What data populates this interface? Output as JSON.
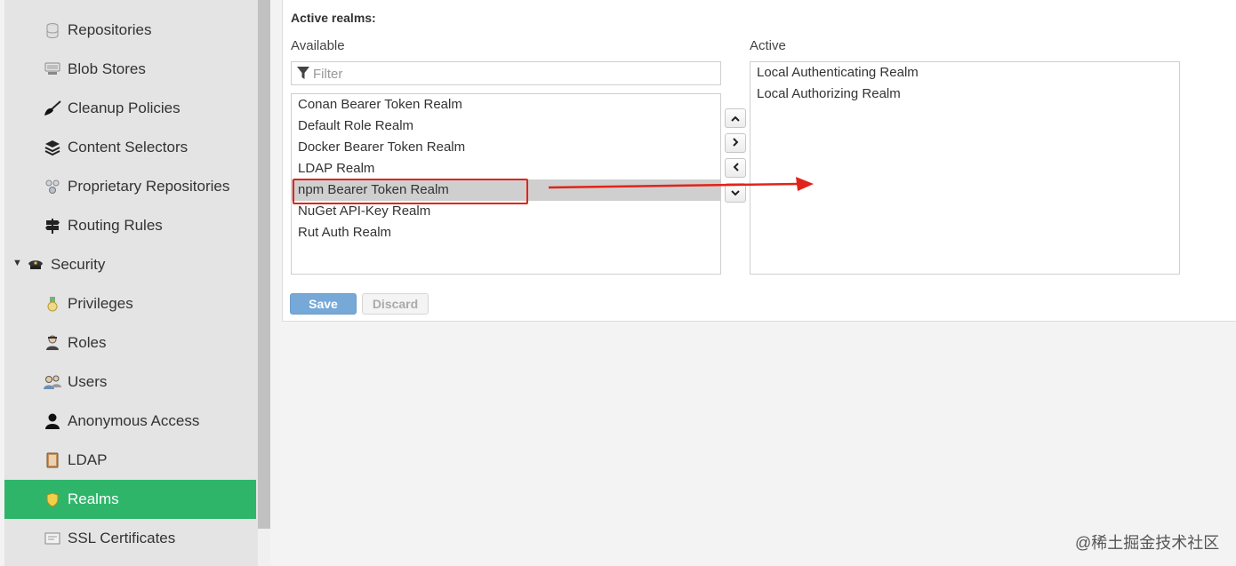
{
  "sidebar": {
    "items": [
      {
        "label": "Repositories",
        "icon": "database-icon"
      },
      {
        "label": "Blob Stores",
        "icon": "server-icon"
      },
      {
        "label": "Cleanup Policies",
        "icon": "broom-icon"
      },
      {
        "label": "Content Selectors",
        "icon": "layers-icon"
      },
      {
        "label": "Proprietary Repositories",
        "icon": "cluster-icon"
      },
      {
        "label": "Routing Rules",
        "icon": "signpost-icon"
      },
      {
        "label": "Security",
        "icon": "police-hat-icon",
        "expanded": true
      },
      {
        "label": "Privileges",
        "icon": "medal-icon"
      },
      {
        "label": "Roles",
        "icon": "user-role-icon"
      },
      {
        "label": "Users",
        "icon": "users-icon"
      },
      {
        "label": "Anonymous Access",
        "icon": "user-silhouette-icon"
      },
      {
        "label": "LDAP",
        "icon": "address-book-icon"
      },
      {
        "label": "Realms",
        "icon": "shield-icon",
        "active": true
      },
      {
        "label": "SSL Certificates",
        "icon": "certificate-icon"
      }
    ]
  },
  "realms": {
    "title": "Active realms:",
    "available_label": "Available",
    "active_label": "Active",
    "filter_placeholder": "Filter",
    "available": [
      "Conan Bearer Token Realm",
      "Default Role Realm",
      "Docker Bearer Token Realm",
      "LDAP Realm",
      "npm Bearer Token Realm",
      "NuGet API-Key Realm",
      "Rut Auth Realm"
    ],
    "selected_available": "npm Bearer Token Realm",
    "active": [
      "Local Authenticating Realm",
      "Local Authorizing Realm"
    ]
  },
  "buttons": {
    "save": "Save",
    "discard": "Discard"
  },
  "annotation": {
    "color": "#e2231a"
  },
  "watermark": "@稀土掘金技术社区",
  "colors": {
    "active_nav": "#2fb56a",
    "save_button": "#77a9d8",
    "selected_row": "#cfcfcf"
  }
}
